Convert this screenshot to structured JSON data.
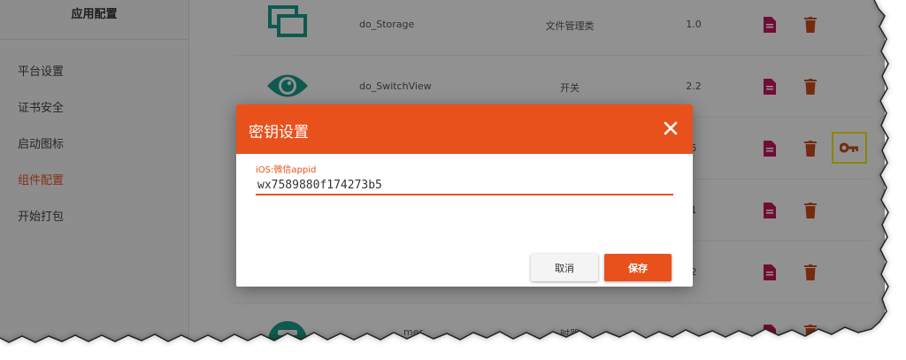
{
  "sidebar": {
    "title": "应用配置",
    "items": [
      {
        "label": "平台设置",
        "active": false
      },
      {
        "label": "证书安全",
        "active": false
      },
      {
        "label": "启动图标",
        "active": false
      },
      {
        "label": "组件配置",
        "active": true
      },
      {
        "label": "开始打包",
        "active": false
      }
    ]
  },
  "components": [
    {
      "name": "do_Storage",
      "category": "文件管理类",
      "version": "1.0",
      "icon": "storage-windows-icon"
    },
    {
      "name": "do_SwitchView",
      "category": "开关",
      "version": "2.2",
      "icon": "eye-icon"
    },
    {
      "name": "",
      "category": "",
      "version": "5",
      "icon": ""
    },
    {
      "name": "",
      "category": "",
      "version": "1",
      "icon": ""
    },
    {
      "name": "",
      "category": "",
      "version": "2",
      "icon": ""
    },
    {
      "name": "mer",
      "category": "时器",
      "version": "",
      "icon": "timer-icon"
    }
  ],
  "colors": {
    "accent": "#e8511c",
    "icon_teal": "#1a9a8a",
    "doc_icon": "#c2185b",
    "delete_icon": "#c84a1a",
    "key_highlight": "#f3e600"
  },
  "dialog": {
    "title": "密钥设置",
    "field_label": "iOS:微信appid",
    "field_value": "wx7589880f174273b5",
    "cancel_label": "取消",
    "save_label": "保存"
  }
}
